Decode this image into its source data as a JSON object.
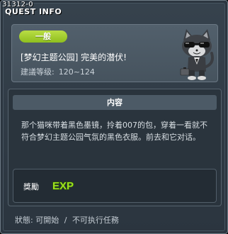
{
  "window": {
    "quest_id": "31312-0",
    "title": "QUEST INFO"
  },
  "header": {
    "category": "一般",
    "quest_name": "[梦幻主题公园] 完美的潜伏!",
    "level_label": "建議等级:",
    "level_range": "120~124"
  },
  "content": {
    "heading": "内容",
    "description": "那个猫咪带着黑色墨镜，拎着007的包，穿着一看就不符合梦幻主题公园气氛的黑色衣服。前去和它对话。"
  },
  "reward": {
    "label": "獎勵",
    "items": [
      "EXP"
    ]
  },
  "status": {
    "label": "狀態:",
    "value_1": "可開始",
    "separator": "/",
    "value_2": "不可执行任務"
  },
  "colors": {
    "category_pill": "#a3cf2f",
    "exp_text": "#9be01f",
    "window_bg": "#2c3640"
  },
  "icons": {
    "npc": "cat-in-sunglasses-npc-icon",
    "reward": "exp-icon"
  }
}
